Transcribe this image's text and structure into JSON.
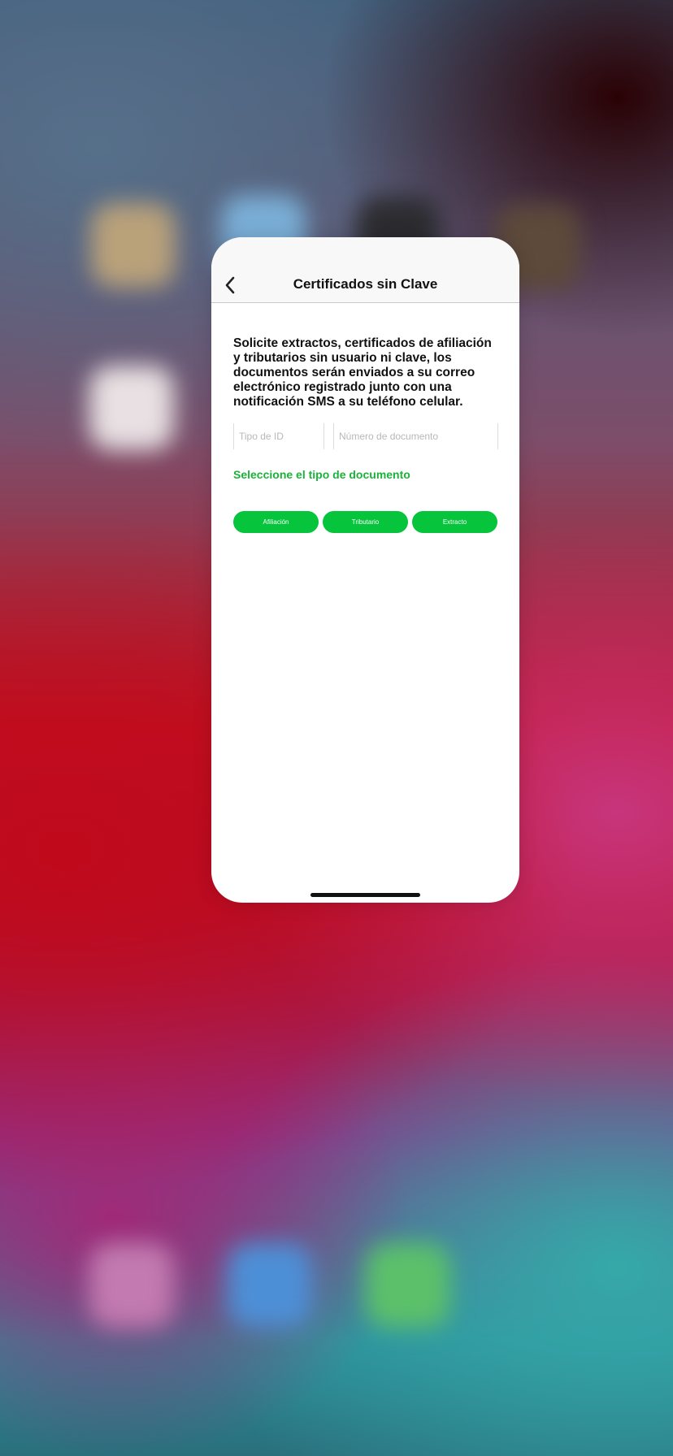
{
  "app": {
    "title": "Certificados sin Clave",
    "back_icon": "chevron-left-icon"
  },
  "intro_text": "Solicite extractos, certificados de afiliación y tributarios sin usuario ni clave, los documentos serán enviados a su correo electrónico registrado junto con una notificación SMS a su teléfono celular.",
  "form": {
    "tipo_id_placeholder": "Tipo de ID",
    "tipo_id_value": "",
    "numero_documento_placeholder": "Número de documento",
    "numero_documento_value": "",
    "select_document_label": "Seleccione el tipo de documento"
  },
  "buttons": {
    "afiliacion": "Afiliación",
    "tributario": "Tributario",
    "extracto": "Extracto"
  },
  "colors": {
    "accent_green": "#06c43b",
    "link_green": "#1ab33a"
  }
}
